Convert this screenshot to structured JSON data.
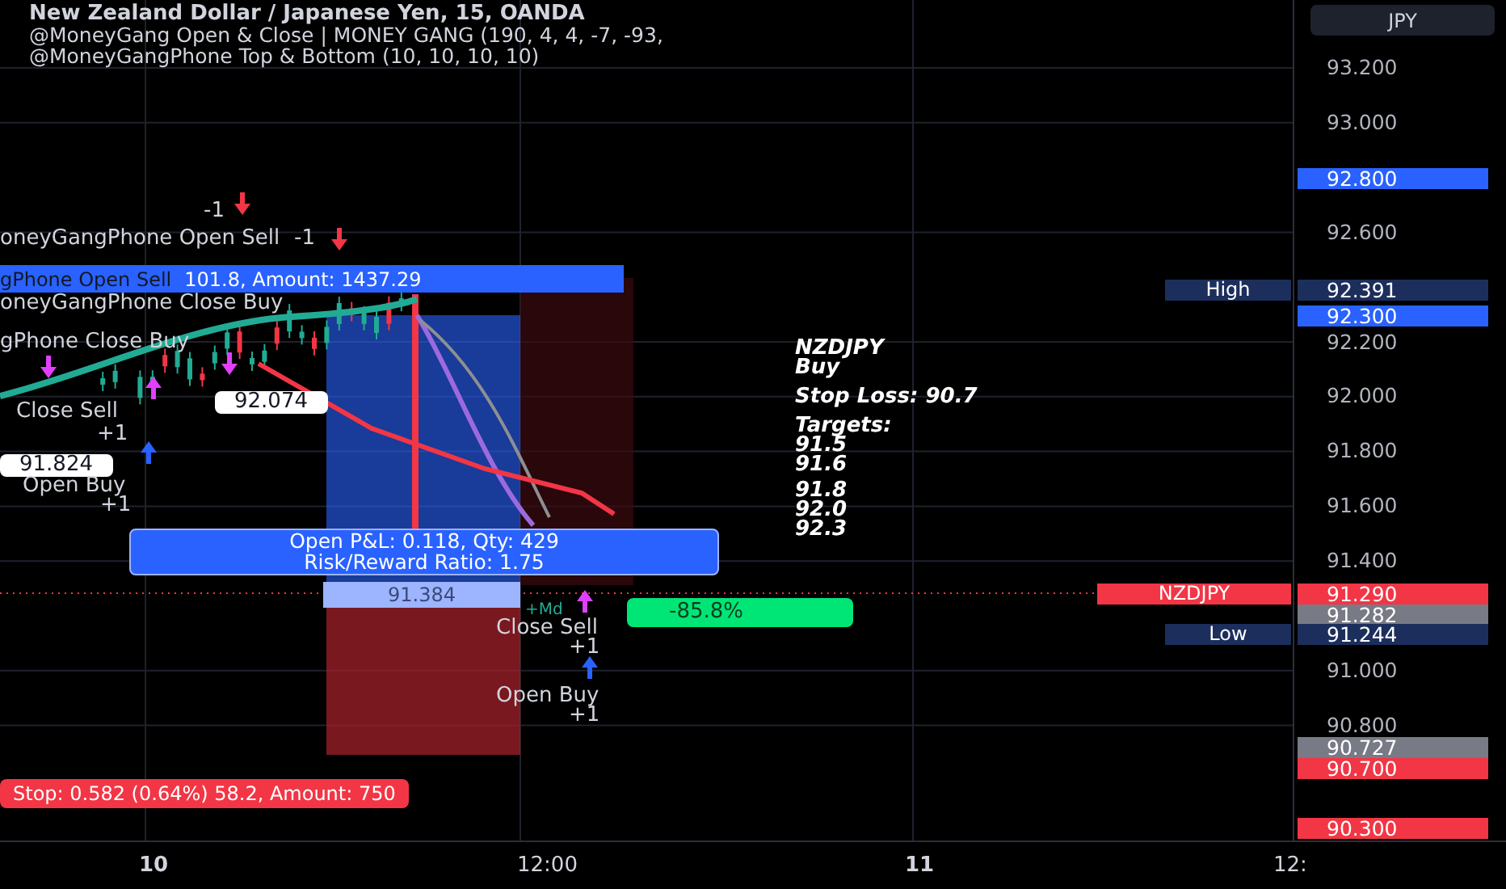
{
  "header": {
    "title": "New Zealand Dollar / Japanese Yen, 15, OANDA",
    "indicators": [
      "@MoneyGang Open & Close | MONEY GANG (190, 4, 4, -7, -93,",
      "@MoneyGangPhone Top & Bottom (10, 10, 10, 10)"
    ]
  },
  "currency_button": "JPY",
  "price_axis": {
    "ticks": [
      "93.200",
      "93.000",
      "92.600",
      "92.200",
      "92.000",
      "91.800",
      "91.600",
      "91.400",
      "91.000",
      "90.800"
    ],
    "markers": [
      {
        "label": "92.800",
        "kind": "blue"
      },
      {
        "label": "92.391",
        "tag": "High",
        "kind": "navy"
      },
      {
        "label": "92.300",
        "kind": "blue"
      },
      {
        "label": "91.290",
        "tag": "NZDJPY",
        "kind": "red"
      },
      {
        "label": "91.282",
        "kind": "gray"
      },
      {
        "label": "91.244",
        "tag": "Low",
        "kind": "navy"
      },
      {
        "label": "90.727",
        "kind": "gray"
      },
      {
        "label": "90.700",
        "kind": "red"
      },
      {
        "label": "90.300",
        "kind": "red"
      }
    ]
  },
  "time_axis": {
    "labels": [
      "10",
      "12:00",
      "11",
      "12:"
    ]
  },
  "annotations": [
    {
      "kind": "text",
      "text": "-1"
    },
    {
      "kind": "text",
      "text": "oneyGangPhone Open Sell"
    },
    {
      "kind": "text",
      "text": "-1"
    },
    {
      "kind": "bar_blue",
      "overlay": "gPhone Open Sell",
      "text": "101.8, Amount: 1437.29"
    },
    {
      "kind": "text",
      "text": "oneyGangPhone Close Buy"
    },
    {
      "kind": "text",
      "text": "gPhone Close Buy"
    },
    {
      "kind": "text",
      "text": "Close Sell"
    },
    {
      "kind": "text",
      "text": "+1"
    },
    {
      "kind": "label_white",
      "text": "92.074"
    },
    {
      "kind": "label_white",
      "text": "91.824"
    },
    {
      "kind": "text",
      "text": "Open Buy"
    },
    {
      "kind": "text",
      "text": "+1"
    },
    {
      "kind": "info_blue",
      "text": "Open P&L: 0.118, Qty: 429",
      "text2": "Risk/Reward Ratio: 1.75"
    },
    {
      "kind": "label_entry",
      "text": "91.384"
    },
    {
      "kind": "box_green",
      "text": "-85.8%"
    },
    {
      "kind": "small",
      "text": "+Md"
    },
    {
      "kind": "text",
      "text": "Close Sell"
    },
    {
      "kind": "text",
      "text": "+1"
    },
    {
      "kind": "text",
      "text": "Open Buy"
    },
    {
      "kind": "text",
      "text": "+1"
    },
    {
      "kind": "bar_red",
      "text": "Stop: 0.582 (0.64%) 58.2, Amount: 750"
    }
  ],
  "signal": [
    "NZDJPY",
    "Buy",
    "Stop Loss: 90.7",
    "Targets:",
    "91.5",
    "91.6",
    "91.8",
    "92.0",
    "92.3"
  ]
}
